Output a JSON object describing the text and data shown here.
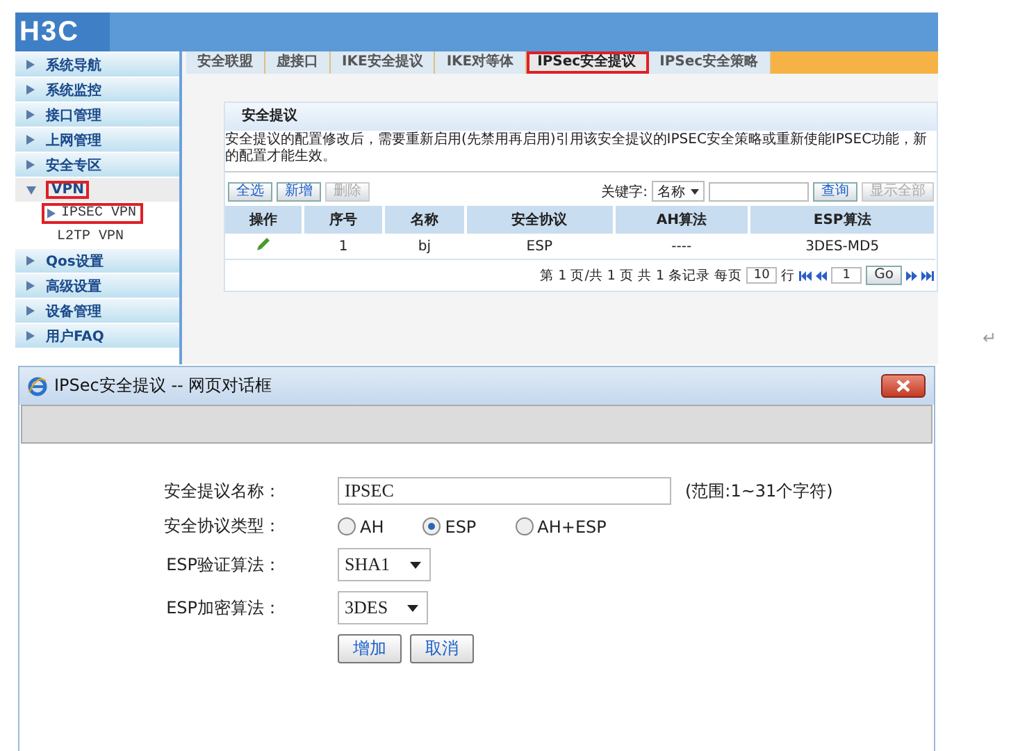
{
  "admin": {
    "logo": "H3C",
    "sidebar": {
      "items": [
        {
          "label": "系统导航",
          "expanded": false,
          "highlighted": false
        },
        {
          "label": "系统监控",
          "expanded": false,
          "highlighted": false
        },
        {
          "label": "接口管理",
          "expanded": false,
          "highlighted": false
        },
        {
          "label": "上网管理",
          "expanded": false,
          "highlighted": false
        },
        {
          "label": "安全专区",
          "expanded": false,
          "highlighted": false
        },
        {
          "label": "VPN",
          "expanded": true,
          "highlighted": true,
          "children": [
            {
              "label": "IPSEC VPN",
              "selected": true
            },
            {
              "label": "L2TP VPN",
              "selected": false
            }
          ]
        },
        {
          "label": "Qos设置",
          "expanded": false,
          "highlighted": false
        },
        {
          "label": "高级设置",
          "expanded": false,
          "highlighted": false
        },
        {
          "label": "设备管理",
          "expanded": false,
          "highlighted": false
        },
        {
          "label": "用户FAQ",
          "expanded": false,
          "highlighted": false
        }
      ]
    },
    "tabs": [
      {
        "label": "安全联盟",
        "selected": false
      },
      {
        "label": "虚接口",
        "selected": false
      },
      {
        "label": "IKE安全提议",
        "selected": false
      },
      {
        "label": "IKE对等体",
        "selected": false
      },
      {
        "label": "IPSec安全提议",
        "selected": true
      },
      {
        "label": "IPSec安全策略",
        "selected": false
      }
    ],
    "panel": {
      "title": "安全提议",
      "notice": "安全提议的配置修改后，需要重新启用(先禁用再启用)引用该安全提议的IPSEC安全策略或重新使能IPSEC功能，新的配置才能生效。",
      "buttons": [
        {
          "label": "全选",
          "disabled": false
        },
        {
          "label": "新增",
          "disabled": false
        },
        {
          "label": "删除",
          "disabled": true
        }
      ],
      "search": {
        "label": "关键字:",
        "field": "名称",
        "query_button": {
          "label": "查询",
          "disabled": false
        },
        "show_all_button": {
          "label": "显示全部",
          "disabled": true
        }
      },
      "table": {
        "columns": [
          "操作",
          "序号",
          "名称",
          "安全协议",
          "AH算法",
          "ESP算法"
        ],
        "rows": [
          [
            "",
            "1",
            "bj",
            "ESP",
            "----",
            "3DES-MD5"
          ]
        ]
      },
      "pagination": {
        "summary": "第 1 页/共 1 页 共 1 条记录 每页",
        "per_page": "10",
        "rows_label": "行",
        "page": "1",
        "go": "Go"
      }
    }
  },
  "paragraph_mark": "↵",
  "dialog": {
    "title": "IPSec安全提议 -- 网页对话框",
    "name_field": {
      "label": "安全提议名称：",
      "value": "IPSEC",
      "hint": "(范围:1~31个字符)"
    },
    "protocol": {
      "label": "安全协议类型：",
      "options": [
        {
          "label": "AH",
          "selected": false
        },
        {
          "label": "ESP",
          "selected": true
        },
        {
          "label": "AH+ESP",
          "selected": false
        }
      ]
    },
    "selects": [
      {
        "label": "ESP验证算法：",
        "value": "SHA1"
      },
      {
        "label": "ESP加密算法：",
        "value": "3DES"
      }
    ],
    "buttons": [
      "增加",
      "取消"
    ]
  }
}
